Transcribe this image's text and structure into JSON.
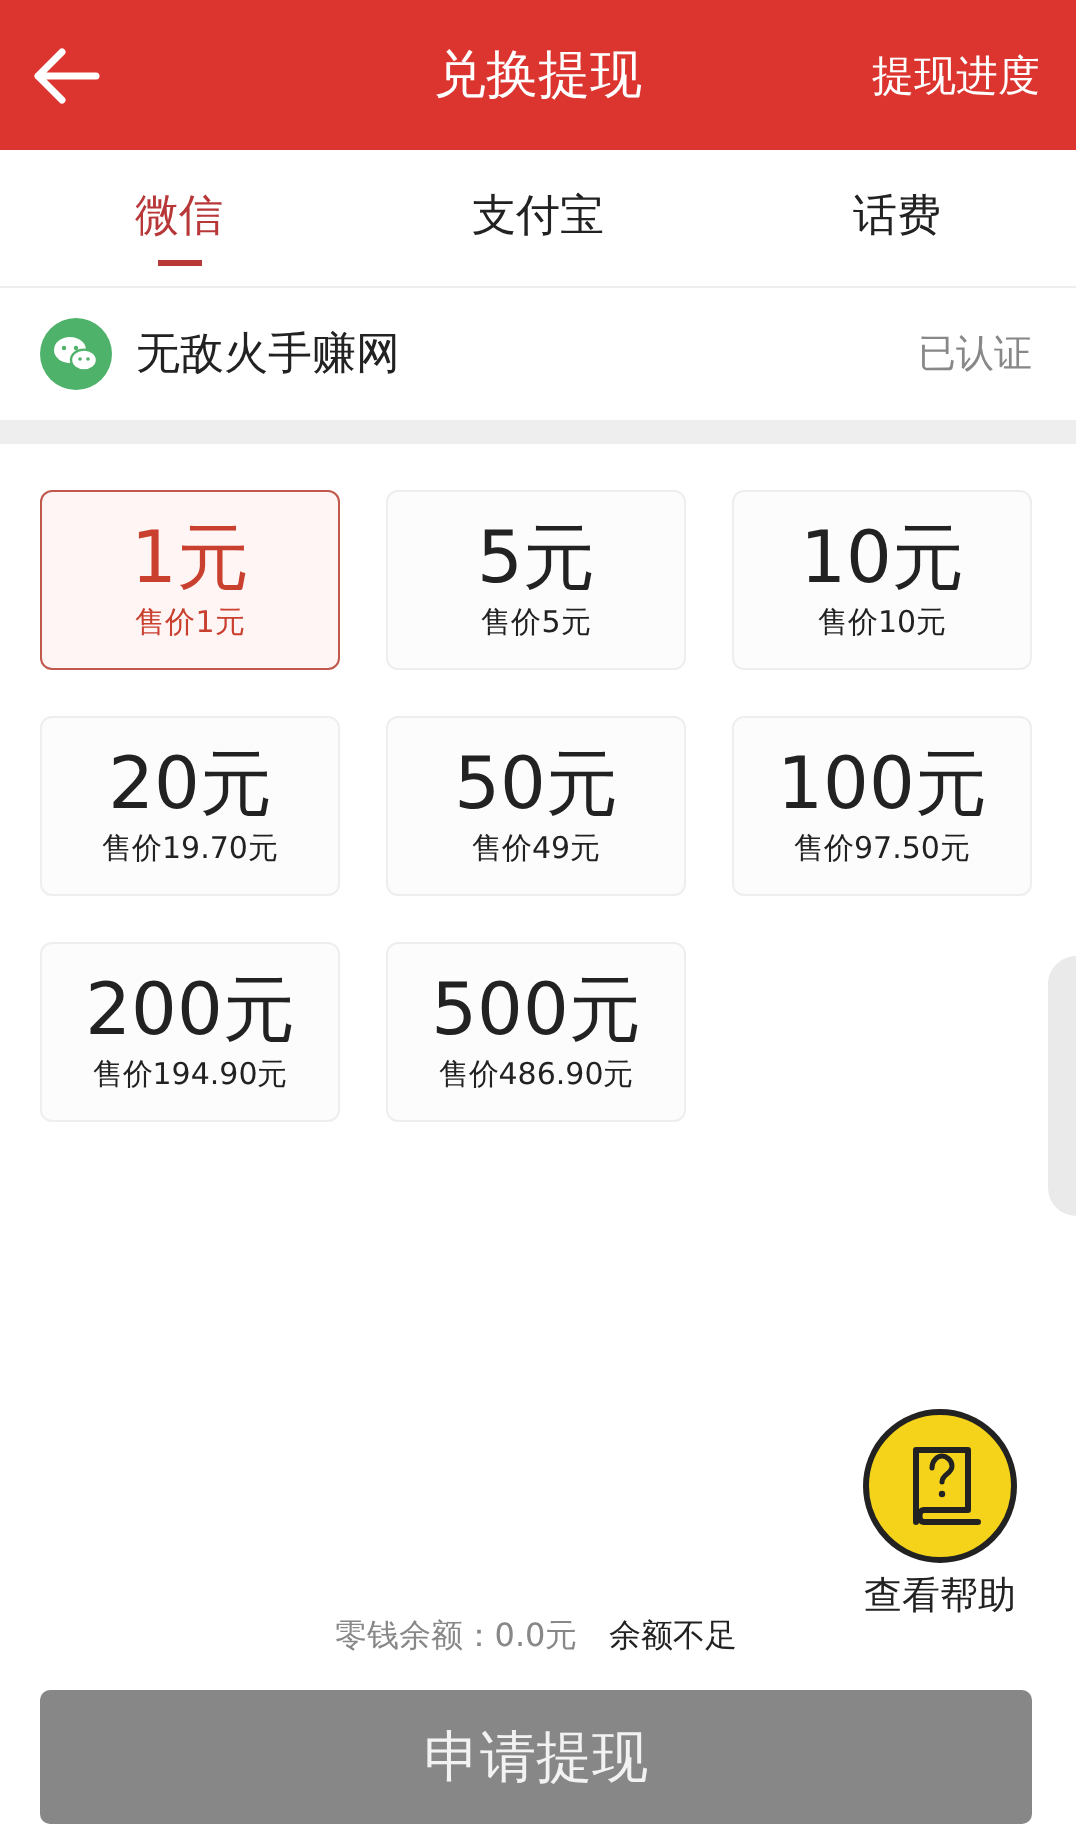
{
  "header": {
    "title": "兑换提现",
    "action": "提现进度"
  },
  "tabs": [
    {
      "label": "微信",
      "selected": true
    },
    {
      "label": "支付宝",
      "selected": false
    },
    {
      "label": "话费",
      "selected": false
    }
  ],
  "account": {
    "name": "无敌火手赚网",
    "status": "已认证"
  },
  "amounts": [
    {
      "amount": "1元",
      "price": "售价1元",
      "selected": true
    },
    {
      "amount": "5元",
      "price": "售价5元",
      "selected": false
    },
    {
      "amount": "10元",
      "price": "售价10元",
      "selected": false
    },
    {
      "amount": "20元",
      "price": "售价19.70元",
      "selected": false
    },
    {
      "amount": "50元",
      "price": "售价49元",
      "selected": false
    },
    {
      "amount": "100元",
      "price": "售价97.50元",
      "selected": false
    },
    {
      "amount": "200元",
      "price": "售价194.90元",
      "selected": false
    },
    {
      "amount": "500元",
      "price": "售价486.90元",
      "selected": false
    }
  ],
  "help": {
    "label": "查看帮助"
  },
  "balance": {
    "label": "零钱余额：0.0元",
    "notice": "余额不足"
  },
  "submit": {
    "label": "申请提现",
    "disabled": true
  }
}
